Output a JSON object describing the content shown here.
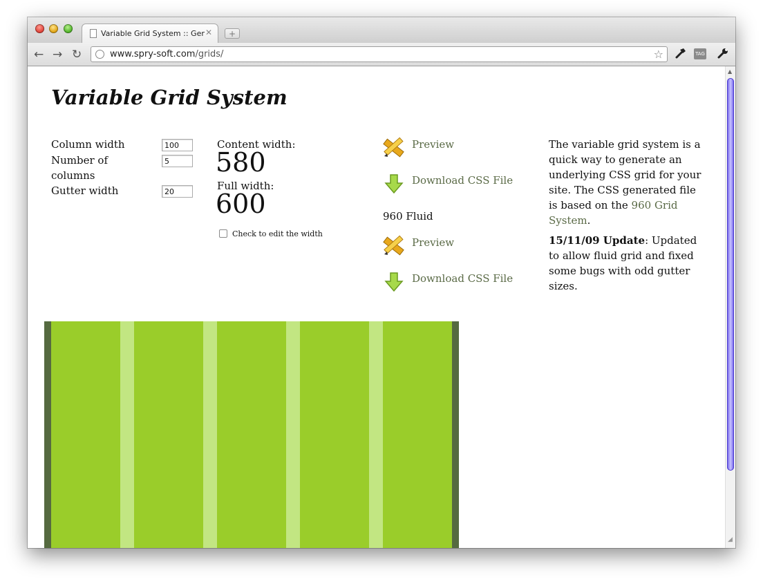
{
  "browser": {
    "tab_title": "Variable Grid System :: Gene",
    "tab_close": "✕",
    "new_tab": "+",
    "url_host": "www.spry-soft.com",
    "url_path": "/grids/",
    "nav_back": "←",
    "nav_forward": "→",
    "nav_reload": "↻",
    "bookmark_star": "☆",
    "tag_label": "TAG"
  },
  "page": {
    "title": "Variable Grid System",
    "form": {
      "column_width_label": "Column width",
      "column_width_value": "100",
      "number_of_columns_label": "Number of columns",
      "number_of_columns_value": "5",
      "gutter_width_label": "Gutter width",
      "gutter_width_value": "20"
    },
    "summary": {
      "content_width_label": "Content width:",
      "content_width_value": "580",
      "full_width_label": "Full width:",
      "full_width_value": "600",
      "edit_width_checkbox_label": "Check to edit the width",
      "edit_width_checked": false
    },
    "actions": {
      "preview": "Preview",
      "download": "Download CSS File",
      "fluid_heading": "960 Fluid",
      "fluid_preview": "Preview",
      "fluid_download": "Download CSS File"
    },
    "description": {
      "intro_before_link": "The variable grid system is a quick way to generate an underlying CSS grid for your site. The CSS generated file is based on the ",
      "intro_link": "960 Grid System",
      "intro_after_link": ".",
      "update_date": "15/11/09 Update",
      "update_text": ": Updated to allow fluid grid and fixed some bugs with odd gutter sizes."
    },
    "grid_demo": {
      "columns": 5,
      "column_width": 100,
      "gutter_width": 20,
      "content_width": 580,
      "full_width": 600,
      "colors": {
        "outer": "#556a40",
        "column": "#9acd2a",
        "gutter": "#c2e682"
      }
    }
  },
  "colors": {
    "link": "#5a6a46",
    "scrollbar_thumb": "#6a5ae8"
  }
}
